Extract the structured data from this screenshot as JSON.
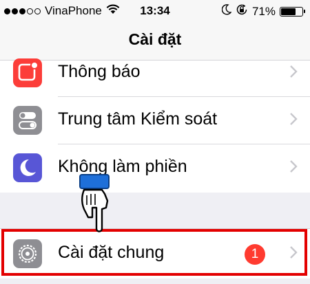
{
  "status_bar": {
    "carrier": "VinaPhone",
    "time": "13:34",
    "battery_percent": "71%",
    "battery_level": 0.71,
    "signal_dots_filled": 3,
    "signal_dots_total": 5,
    "icons": [
      "signal-dots-icon",
      "wifi-icon",
      "moon-icon",
      "rotation-lock-icon",
      "battery-icon"
    ]
  },
  "nav": {
    "title": "Cài đặt"
  },
  "rows": [
    {
      "label": "Thông báo",
      "icon": "notifications-icon",
      "icon_color": "#fc3d39"
    },
    {
      "label": "Trung tâm Kiểm soát",
      "icon": "control-center-icon",
      "icon_color": "#8e8e93"
    },
    {
      "label": "Không làm phiền",
      "icon": "do-not-disturb-icon",
      "icon_color": "#5856d6"
    },
    {
      "label": "Cài đặt chung",
      "icon": "general-gear-icon",
      "icon_color": "#8e8e93",
      "badge": "1"
    }
  ],
  "colors": {
    "background": "#efeff4",
    "highlight": "#e30000",
    "badge": "#ff3b30",
    "pointer_cuff": "#1e6fd9"
  }
}
